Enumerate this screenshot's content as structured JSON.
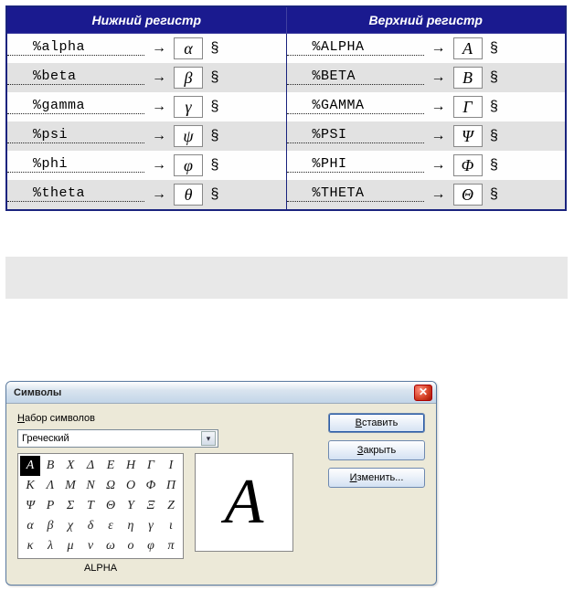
{
  "table": {
    "header_left": "Нижний регистр",
    "header_right": "Верхний регистр",
    "arrow": "→",
    "section_mark": "§",
    "rows": [
      {
        "lower_code": "%alpha",
        "lower_sym": "α",
        "upper_code": "%ALPHA",
        "upper_sym": "A"
      },
      {
        "lower_code": "%beta",
        "lower_sym": "β",
        "upper_code": "%BETA",
        "upper_sym": "B"
      },
      {
        "lower_code": "%gamma",
        "lower_sym": "γ",
        "upper_code": "%GAMMA",
        "upper_sym": "Γ"
      },
      {
        "lower_code": "%psi",
        "lower_sym": "ψ",
        "upper_code": "%PSI",
        "upper_sym": "Ψ"
      },
      {
        "lower_code": "%phi",
        "lower_sym": "φ",
        "upper_code": "%PHI",
        "upper_sym": "Φ"
      },
      {
        "lower_code": "%theta",
        "lower_sym": "θ",
        "upper_code": "%THETA",
        "upper_sym": "Θ"
      }
    ]
  },
  "dialog": {
    "title": "Символы",
    "close_label": "✕",
    "charset_label_u": "Н",
    "charset_label_rest": "абор символов",
    "charset_value": "Греческий",
    "grid": [
      [
        "A",
        "B",
        "X",
        "Δ",
        "E",
        "H",
        "Γ",
        "I"
      ],
      [
        "K",
        "Λ",
        "M",
        "N",
        "Ω",
        "O",
        "Φ",
        "Π"
      ],
      [
        "Ψ",
        "P",
        "Σ",
        "T",
        "Θ",
        "Y",
        "Ξ",
        "Z"
      ],
      [
        "α",
        "β",
        "χ",
        "δ",
        "ε",
        "η",
        "γ",
        "ι"
      ],
      [
        "κ",
        "λ",
        "μ",
        "ν",
        "ω",
        "o",
        "φ",
        "π"
      ]
    ],
    "selected_row": 0,
    "selected_col": 0,
    "grid_caption": "ALPHA",
    "preview_char": "A",
    "buttons": {
      "insert_u": "В",
      "insert_rest": "ставить",
      "close_u": "З",
      "close_rest": "акрыть",
      "edit_u": "И",
      "edit_rest": "зменить..."
    }
  }
}
